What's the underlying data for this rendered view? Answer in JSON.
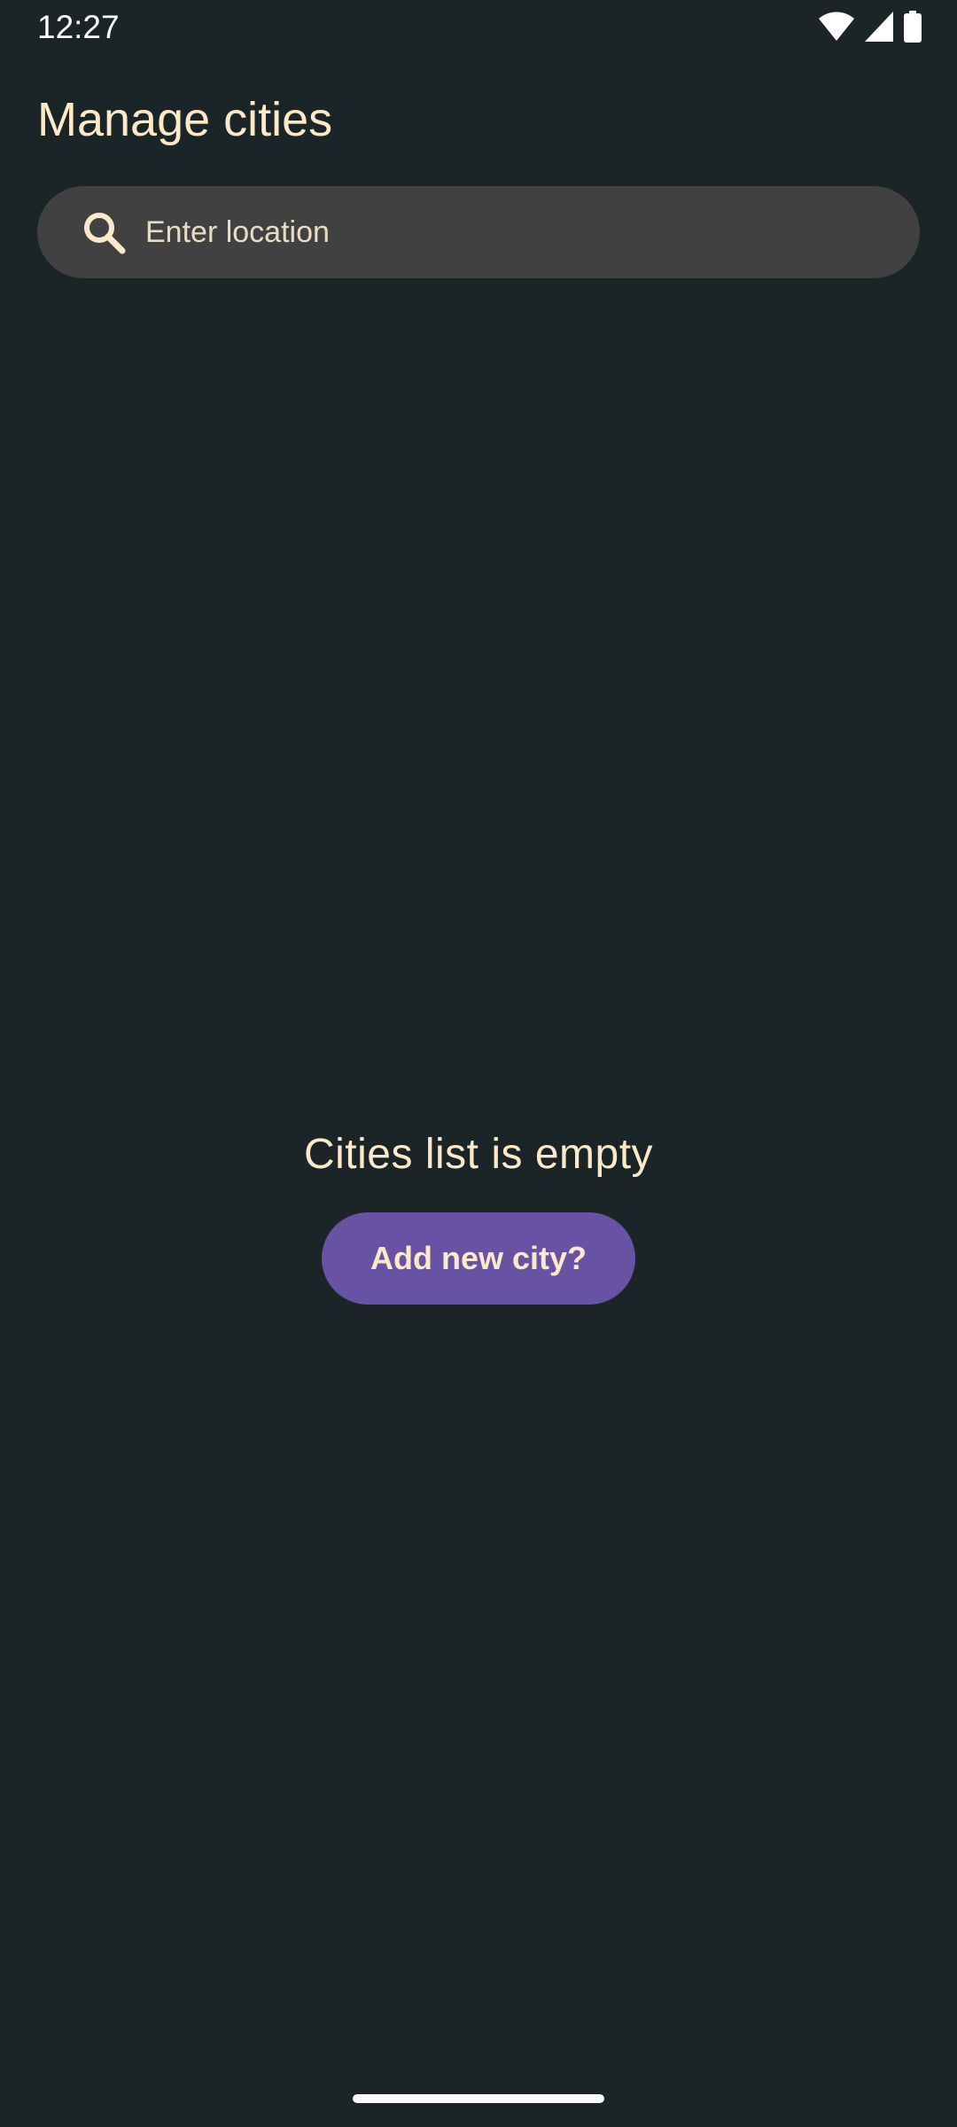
{
  "status_bar": {
    "time": "12:27",
    "icons": [
      "wifi-icon",
      "cellular-signal-icon",
      "battery-icon"
    ]
  },
  "page": {
    "title": "Manage cities"
  },
  "search": {
    "placeholder": "Enter location",
    "value": "",
    "icon": "search-icon"
  },
  "empty_state": {
    "message": "Cities list is empty",
    "action_label": "Add new city?"
  },
  "colors": {
    "background": "#1b2426",
    "accent_text": "#fbe9c9",
    "search_bg": "#414141",
    "button_bg": "#6752a4"
  }
}
